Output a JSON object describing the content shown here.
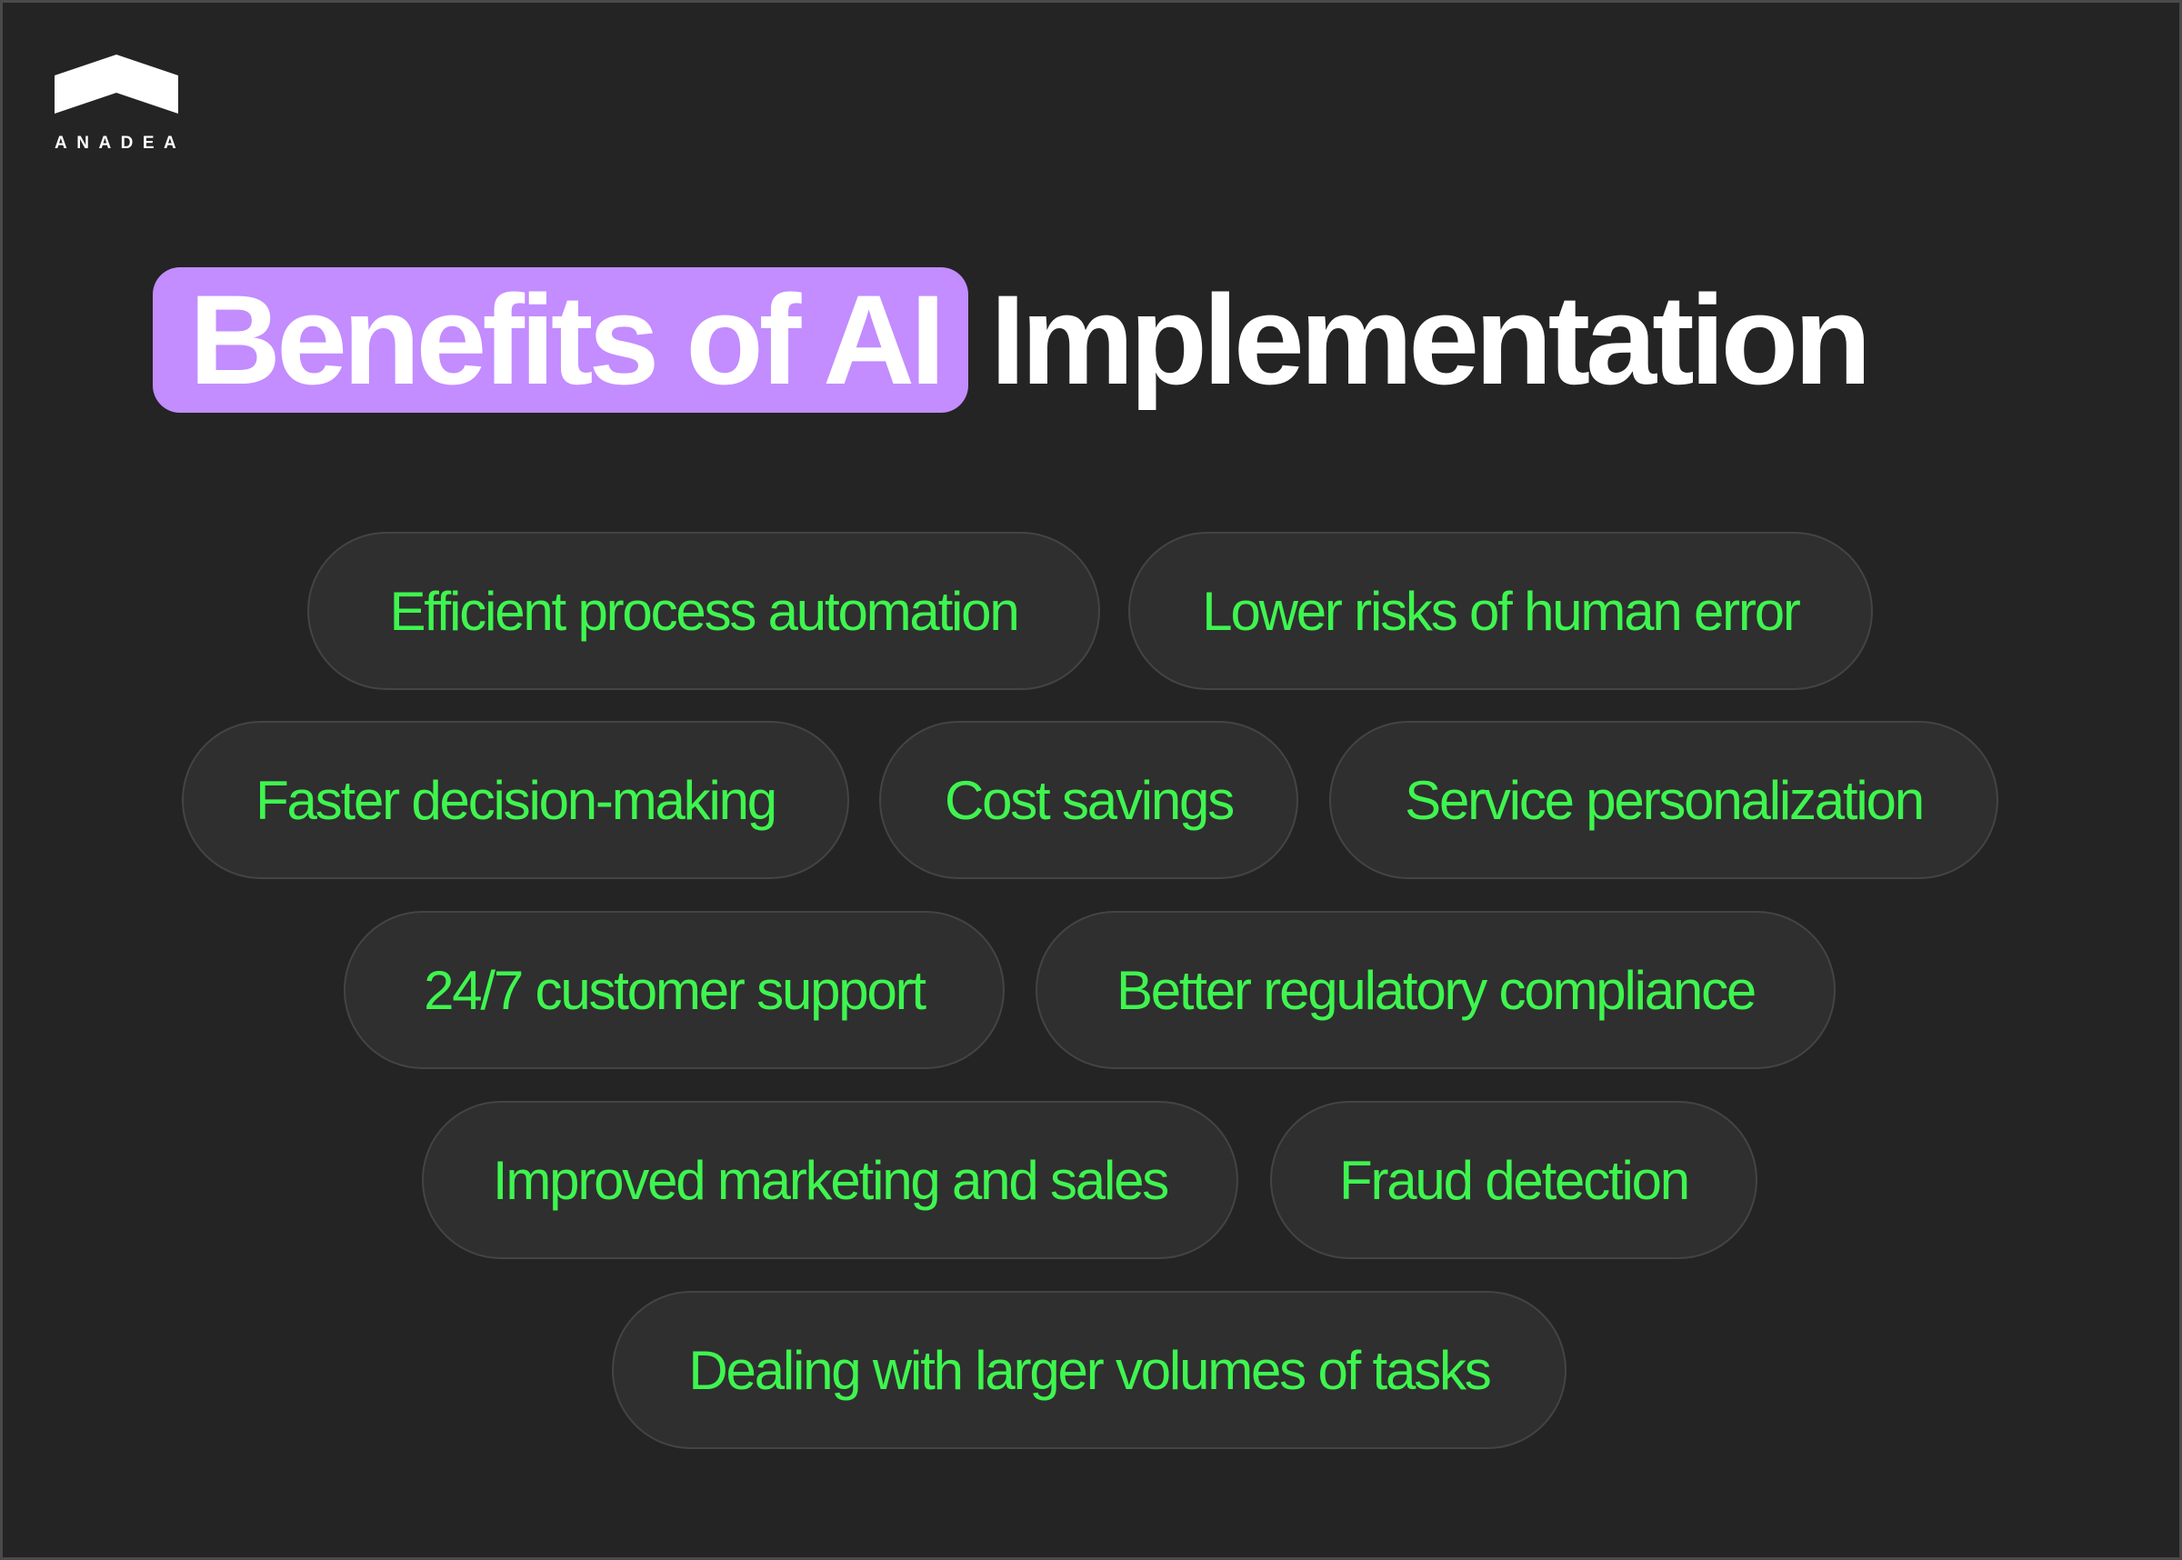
{
  "brand": {
    "name": "ANADEA",
    "logo_icon": "chevron-roof-icon"
  },
  "title": {
    "highlight": "Benefits of AI",
    "rest": "Implementation"
  },
  "colors": {
    "background": "#242424",
    "highlight": "#c38cff",
    "pill_text": "#3ef54f",
    "pill_bg": "#2f2f2f"
  },
  "benefits": [
    "Efficient process automation",
    "Lower risks of human error",
    "Faster decision-making",
    "Cost savings",
    "Service personalization",
    "24/7 customer support",
    "Better regulatory compliance",
    "Improved marketing and sales",
    "Fraud detection",
    "Dealing with larger volumes of tasks"
  ]
}
